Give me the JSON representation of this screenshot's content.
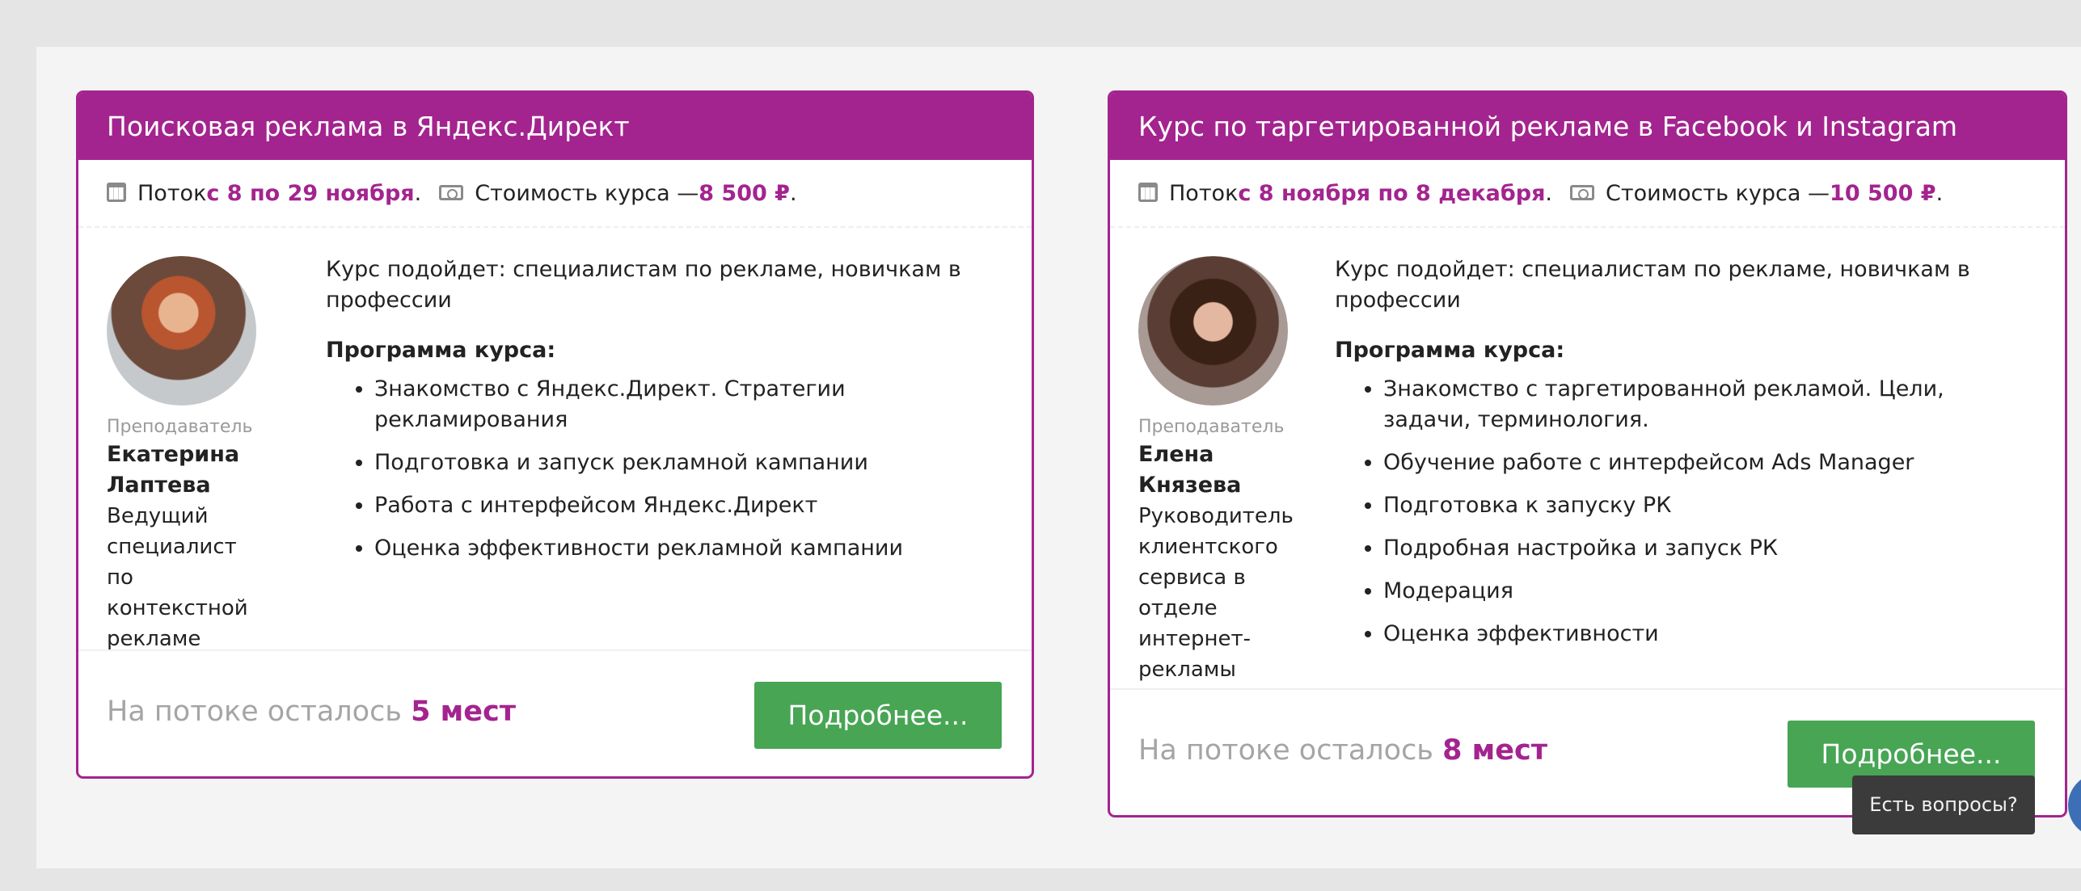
{
  "courses": [
    {
      "title": "Поисковая реклама в Яндекс.Директ",
      "stream_prefix": "Поток ",
      "stream_dates": "с 8 по 29 ноября",
      "stream_suffix": ".",
      "price_prefix": "Стоимость курса — ",
      "price": "8 500 ₽",
      "price_suffix": ".",
      "teacher_role": "Преподаватель",
      "teacher_name": "Екатерина Лаптева",
      "teacher_position": "Ведущий специалист по контекстной рекламе",
      "fits": "Курс подойдет: специалистам по рекламе, новичкам в профессии",
      "program_title": "Программа курса:",
      "program": [
        "Знакомство с Яндекс.Директ. Стратегии рекламирования",
        "Подготовка и запуск рекламной кампании",
        "Работа с интерфейсом Яндекс.Директ",
        "Оценка эффективности рекламной кампании"
      ],
      "seats_prefix": "На потоке осталось ",
      "seats": "5 мест",
      "button": "Подробнее..."
    },
    {
      "title": "Курс по таргетированной рекламе в Facebook и Instagram",
      "stream_prefix": "Поток ",
      "stream_dates": "с 8 ноября по 8 декабря",
      "stream_suffix": ".",
      "price_prefix": "Стоимость курса — ",
      "price": "10 500 ₽",
      "price_suffix": ".",
      "teacher_role": "Преподаватель",
      "teacher_name": "Елена Князева",
      "teacher_position": "Руководитель клиентского сервиса в отделе интернет-рекламы",
      "fits": "Курс подойдет: специалистам по рекламе, новичкам в профессии",
      "program_title": "Программа курса:",
      "program": [
        "Знакомство с таргетированной рекламой. Цели, задачи, терминология.",
        "Обучение работе с интерфейсом Ads Manager",
        "Подготовка к запуску РК",
        "Подробная настройка и запуск РК",
        "Модерация",
        "Оценка эффективности"
      ],
      "seats_prefix": "На потоке осталось ",
      "seats": "8 мест",
      "button": "Подробнее..."
    }
  ],
  "tooltip": "Есть вопросы?",
  "icons": {
    "calendar": "calendar-icon",
    "price": "money-icon"
  },
  "colors": {
    "brand": "#a3248f",
    "button": "#47a554"
  }
}
